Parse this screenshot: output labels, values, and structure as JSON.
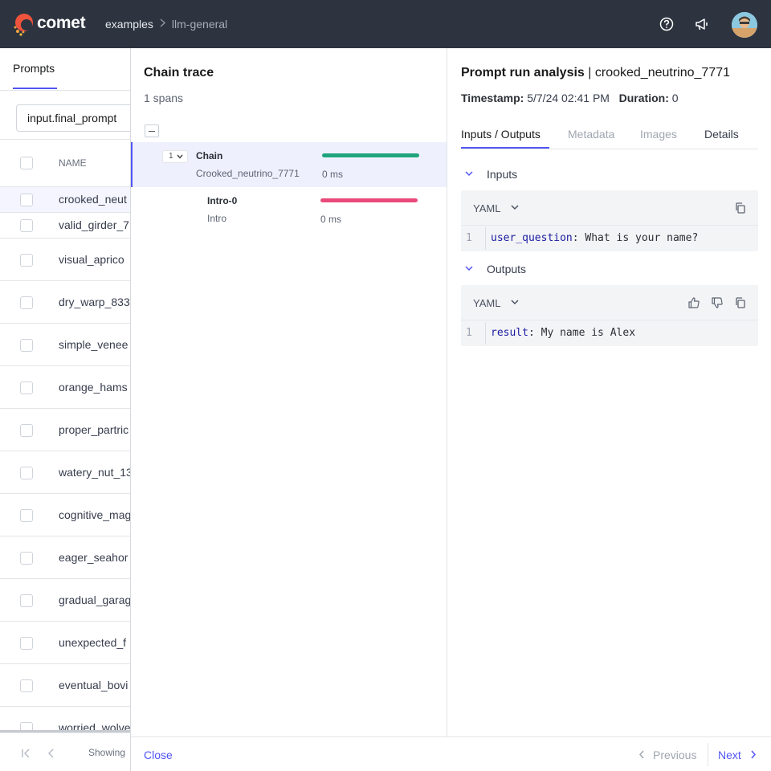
{
  "topbar": {
    "logo_text": "comet",
    "breadcrumb": [
      "examples",
      "llm-general"
    ]
  },
  "background_table": {
    "tab_label": "Prompts",
    "filter_value": "input.final_prompt",
    "column_header": "NAME",
    "rows": [
      "crooked_neut",
      "valid_girder_7",
      "visual_aprico",
      "dry_warp_833",
      "simple_venee",
      "orange_hams",
      "proper_partric",
      "watery_nut_13",
      "cognitive_mag",
      "eager_seahor",
      "gradual_garag",
      "unexpected_f",
      "eventual_bovi",
      "worried_wolve"
    ],
    "footer_showing": "Showing"
  },
  "trace": {
    "title": "Chain trace",
    "subtitle": "1 spans",
    "spans": [
      {
        "count": "1",
        "name": "Chain",
        "type": "Crooked_neutrino_7771",
        "duration": "0 ms",
        "bar_color": "#1fa57c"
      },
      {
        "name": "Intro-0",
        "type": "Intro",
        "duration": "0 ms",
        "bar_color": "#e94a7b"
      }
    ]
  },
  "analysis": {
    "title_bold": "Prompt run analysis",
    "title_rest": " | crooked_neutrino_7771",
    "timestamp_label": "Timestamp:",
    "timestamp_value": "5/7/24 02:41 PM",
    "duration_label": "Duration:",
    "duration_value": "0",
    "tabs": [
      "Inputs / Outputs",
      "Metadata",
      "Images",
      "Details"
    ],
    "inputs": {
      "label": "Inputs",
      "format": "YAML",
      "line_number": "1",
      "key": "user_question",
      "value": ": What is your name?"
    },
    "outputs": {
      "label": "Outputs",
      "format": "YAML",
      "line_number": "1",
      "key": "result",
      "value": ": My name is Alex"
    }
  },
  "footer": {
    "close": "Close",
    "previous": "Previous",
    "next": "Next"
  },
  "colors": {
    "accent": "#5155f5",
    "topbar": "#2d3440"
  }
}
